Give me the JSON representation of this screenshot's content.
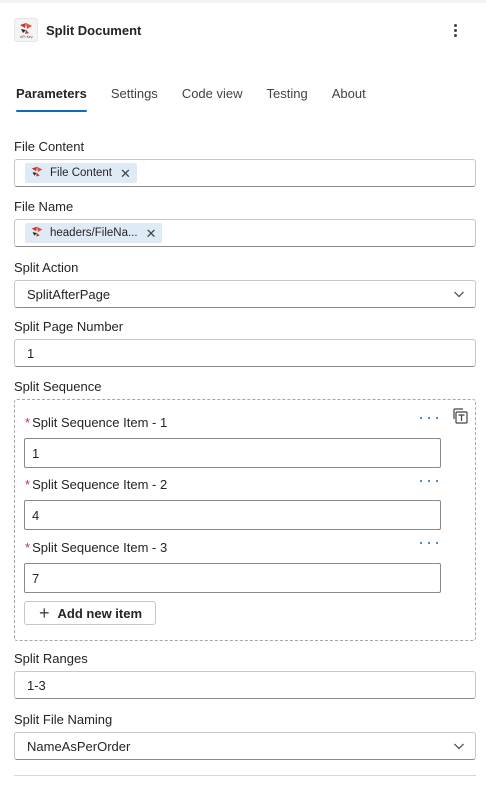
{
  "header": {
    "title": "Split Document",
    "logo_icon": "pdf4me-logo-icon"
  },
  "tabs": [
    {
      "label": "Parameters",
      "active": true
    },
    {
      "label": "Settings",
      "active": false
    },
    {
      "label": "Code view",
      "active": false
    },
    {
      "label": "Testing",
      "active": false
    },
    {
      "label": "About",
      "active": false
    }
  ],
  "params": {
    "file_content": {
      "label": "File Content",
      "token": "File Content"
    },
    "file_name": {
      "label": "File Name",
      "token": "headers/FileNa..."
    },
    "split_action": {
      "label": "Split Action",
      "value": "SplitAfterPage"
    },
    "split_page_number": {
      "label": "Split Page Number",
      "value": "1"
    },
    "split_sequence": {
      "label": "Split Sequence",
      "items": [
        {
          "label": "Split Sequence Item - 1",
          "value": "1"
        },
        {
          "label": "Split Sequence Item - 2",
          "value": "4"
        },
        {
          "label": "Split Sequence Item - 3",
          "value": "7"
        }
      ],
      "add_label": "Add new item"
    },
    "split_ranges": {
      "label": "Split Ranges",
      "value": "1-3"
    },
    "split_file_naming": {
      "label": "Split File Naming",
      "value": "NameAsPerOrder"
    }
  },
  "colors": {
    "accent": "#0f6cbd",
    "required": "#c4314b",
    "token_bg": "#dfeaf7"
  }
}
